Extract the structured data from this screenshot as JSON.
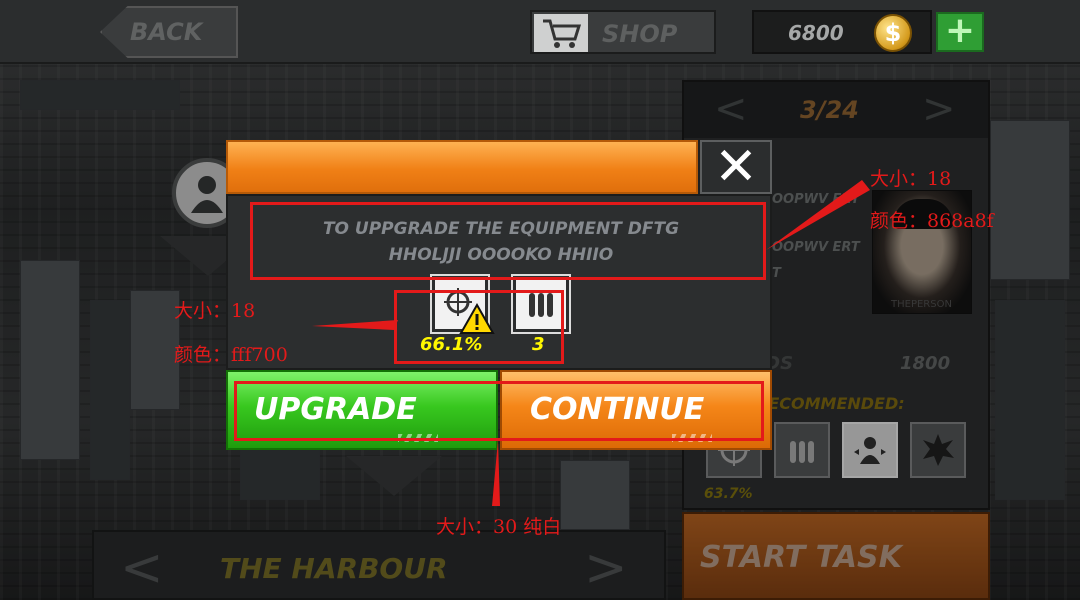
{
  "topbar": {
    "back_label": "BACK",
    "shop_label": "SHOP",
    "coins": "6800",
    "coin_symbol": "$",
    "plus_symbol": "+"
  },
  "right_panel": {
    "page_indicator": "3/24",
    "prev_symbol": "<",
    "next_symbol": ">",
    "info_line_1": "OOPWV ERT",
    "info_line_2": "OOPWV ERT",
    "info_line_3": "T",
    "portrait_caption": "THEPERSON",
    "rewards_label": "REWARDS",
    "rewards_value": "1800",
    "recommended_label": "RECOMMENDED:",
    "slot_1_pct": "63.7%",
    "start_task_label": "START TASK"
  },
  "location": {
    "name": "THE HARBOUR",
    "prev_symbol": "<",
    "next_symbol": ">"
  },
  "dialog": {
    "message_line_1": "TO UPPGRADE THE EQUIPMENT DFTG",
    "message_line_2": "HHOLJJI OOOOKO HHIIO",
    "close_symbol": "✕",
    "items": [
      {
        "icon": "scope-icon",
        "value": "66.1%"
      },
      {
        "icon": "ammo-icon",
        "value": "3"
      }
    ],
    "upgrade_label": "UPGRADE",
    "continue_label": "CONTINUE"
  },
  "annotations": {
    "top_size": "大小：18",
    "top_color": "颜色：868a8f",
    "left_size": "大小：18",
    "left_color": "颜色：fff700",
    "bottom_note": "大小：30  纯白"
  },
  "colors": {
    "message_text": "#868a8f",
    "item_value_text": "#fff700",
    "button_text": "#ffffff",
    "upgrade_green": "#38c81f",
    "continue_orange": "#f58618",
    "annotation_red": "#e31a1a"
  }
}
